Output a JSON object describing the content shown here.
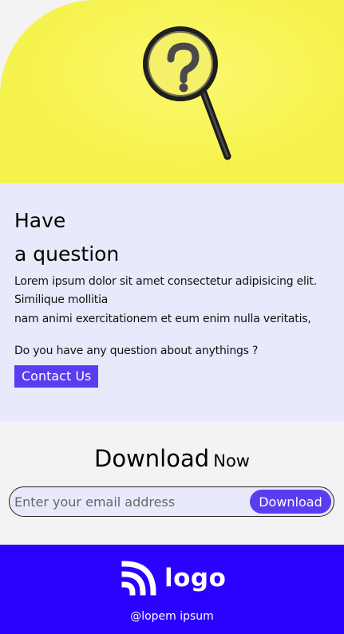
{
  "hero": {
    "image_icon": "magnifying-glass-question-icon",
    "colors": {
      "background": "#f6f24d"
    }
  },
  "question": {
    "title_line1": "Have",
    "title_line2": "a question",
    "body_line1": "Lorem ipsum dolor sit amet consectetur adipisicing elit. Similique mollitia",
    "body_line2": "nam animi exercitationem et eum enim nulla veritatis,",
    "ask": "Do you have any question about anythings ?",
    "contact_label": "Contact Us"
  },
  "download": {
    "title_big": "Download",
    "title_small": "Now",
    "email_placeholder": "Enter your email address",
    "button_label": "Download"
  },
  "footer": {
    "logo_text": "logo",
    "logo_icon": "rss-feed-icon",
    "subtext": "@lopem ipsum",
    "colors": {
      "background": "#2a00ff",
      "accent": "#5b3cf0"
    }
  }
}
